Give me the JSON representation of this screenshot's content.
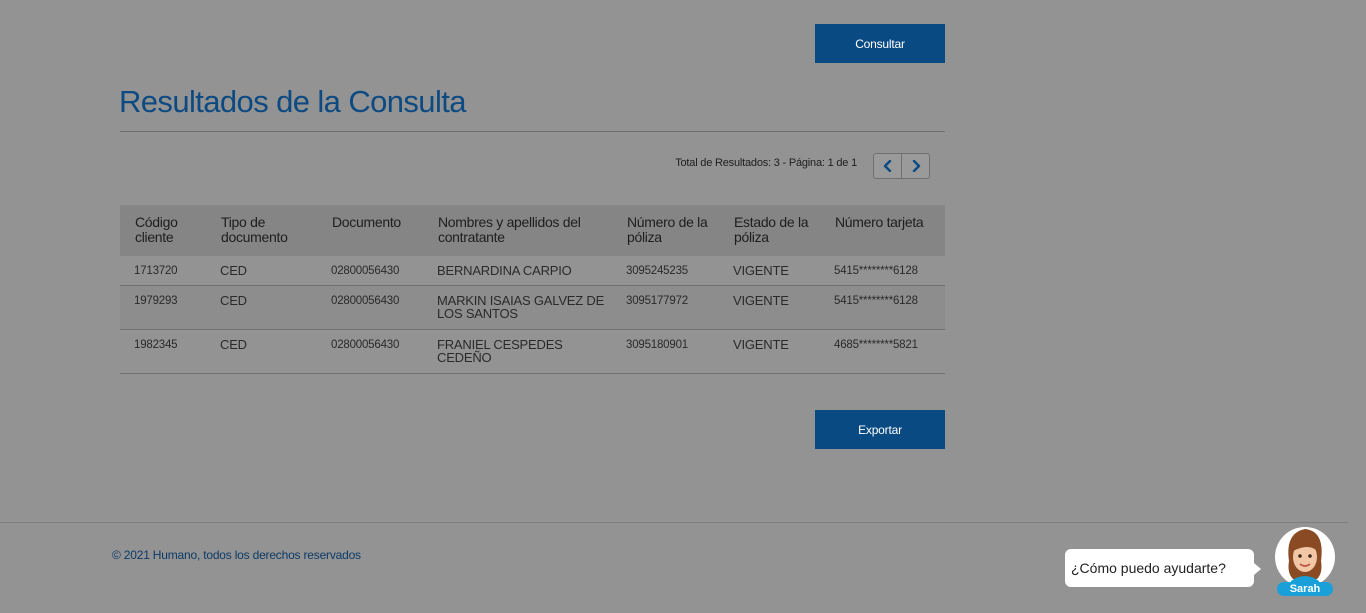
{
  "actions": {
    "consultar_label": "Consultar",
    "exportar_label": "Exportar"
  },
  "results": {
    "title": "Resultados de la Consulta",
    "pager_text": "Total de Resultados: 3 - Página: 1 de 1",
    "columns": [
      "Código cliente",
      "Tipo de documento",
      "Documento",
      "Nombres y apellidos del contratante",
      "Número de la póliza",
      "Estado de la póliza",
      "Número tarjeta"
    ],
    "rows": [
      [
        "1713720",
        "CED",
        "02800056430",
        "BERNARDINA CARPIO",
        "3095245235",
        "VIGENTE",
        "5415********6128"
      ],
      [
        "1979293",
        "CED",
        "02800056430",
        "MARKIN ISAIAS GALVEZ DE LOS SANTOS",
        "3095177972",
        "VIGENTE",
        "5415********6128"
      ],
      [
        "1982345",
        "CED",
        "02800056430",
        "FRANIEL CESPEDES CEDEÑO",
        "3095180901",
        "VIGENTE",
        "4685********5821"
      ]
    ]
  },
  "footer": {
    "copyright": "© 2021 Humano, todos los derechos reservados"
  },
  "chat": {
    "prompt": "¿Cómo puedo ayudarte?",
    "assistant_name": "Sarah"
  },
  "colors": {
    "accent": "#0a4a82",
    "overlay_background": "#939393",
    "chat_badge": "#1aa0d8"
  },
  "icons": {
    "prev": "chevron-left-icon",
    "next": "chevron-right-icon"
  }
}
